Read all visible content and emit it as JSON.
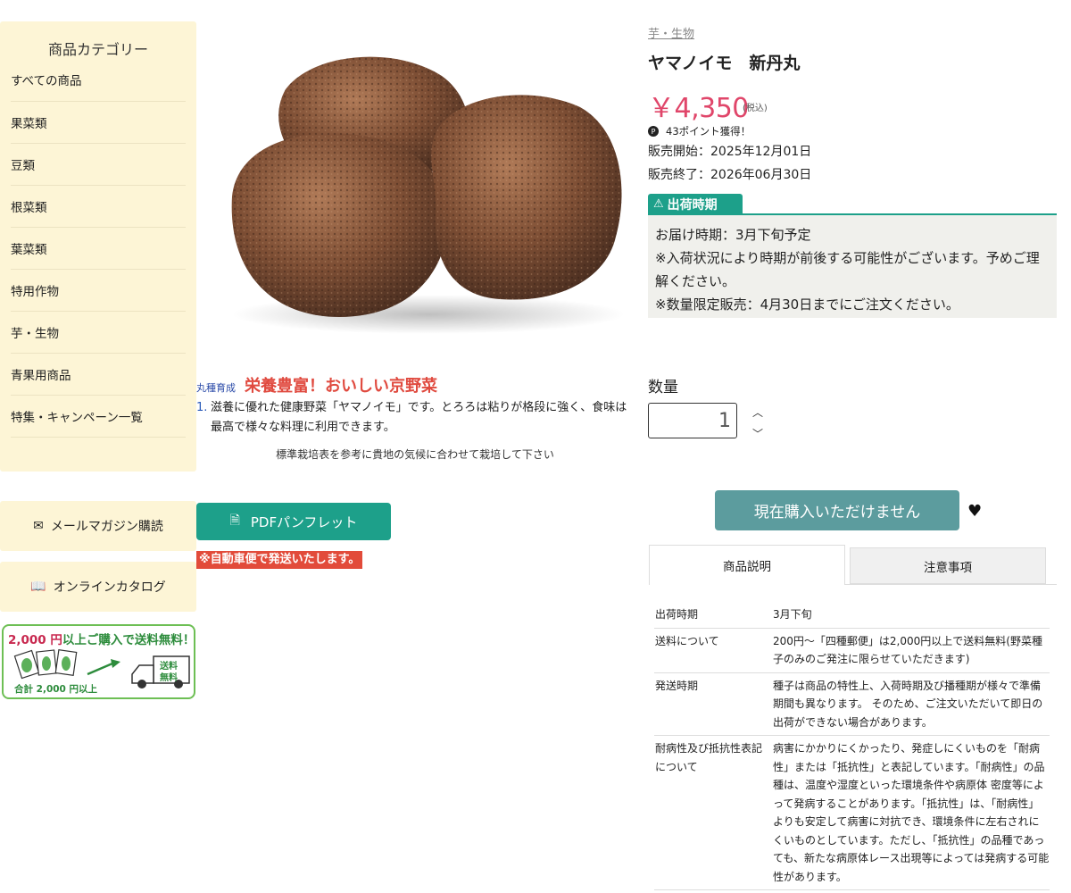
{
  "sidebar": {
    "category_title": "商品カテゴリー",
    "categories": [
      "すべての商品",
      "果菜類",
      "豆類",
      "根菜類",
      "葉菜類",
      "特用作物",
      "芋・生物",
      "青果用商品",
      "特集・キャンペーン一覧"
    ],
    "mail_magazine": "メールマガジン購読",
    "online_catalog": "オンラインカタログ",
    "shipping_banner": {
      "amount": "2,000 円",
      "text": "以上ご購入で送料無料！",
      "truck_label_1": "送料",
      "truck_label_2": "無料",
      "total_label": "合計 2,000 円以上"
    }
  },
  "product": {
    "breadcrumb": "芋・生物",
    "title": "ヤマノイモ　新丹丸",
    "price": "￥4,350",
    "tax_note": "(税込)",
    "points": "43ポイント獲得！",
    "sale_start": "販売開始：2025年12月01日",
    "sale_end": "販売終了：2026年06月30日",
    "shipping_period_label": "出荷時期",
    "shipping_lines": [
      "お届け時期：3月下旬予定",
      "※入荷状況により時期が前後する可能性がございます。予めご理解ください。",
      "※数量限定販売：4月30日までにご注文ください。"
    ],
    "quantity_label": "数量",
    "quantity_value": "1",
    "buy_button": "現在購入いただけません"
  },
  "description": {
    "variety": "丸種育成",
    "headline": "栄養豊富！おいしい京野菜",
    "item_number": "1.",
    "item_text": "滋養に優れた健康野菜「ヤマノイモ」です。とろろは粘りが格段に強く、食味は最高で様々な料理に利用できます。",
    "cultivation_note": "標準栽培表を参考に貴地の気候に合わせて栽培して下さい",
    "pdf_button": "PDFパンフレット",
    "shipping_note": "※自動車便で発送いたします。"
  },
  "tabs": {
    "description": "商品説明",
    "notes": "注意事項"
  },
  "spec": {
    "rows": [
      {
        "key": "出荷時期",
        "value": "3月下旬"
      },
      {
        "key": "送料について",
        "value": "200円〜「四種郵便」は2,000円以上で送料無料(野菜種子のみのご発注に限らせていただきます)"
      },
      {
        "key": "発送時期",
        "value": "種子は商品の特性上、入荷時期及び播種期が様々で準備期間も異なります。 そのため、ご注文いただいて即日の出荷ができない場合があります。"
      },
      {
        "key": "耐病性及び抵抗性表記について",
        "value": "病害にかかりにくかったり、発症しにくいものを「耐病性」または「抵抗性」と表記しています。「耐病性」の品種は、温度や湿度といった環境条件や病原体 密度等によって発病することがあります。「抵抗性」は、「耐病性」よりも安定して病害に対抗でき、環境条件に左右されにくいものとしています。ただし、「抵抗性」の品種であっても、新たな病原体レース出現等によっては発病する可能性があります。"
      }
    ]
  },
  "colors": {
    "sidebar_bg": "#fdf5d6",
    "accent_green": "#1da08a",
    "price_pink": "#e0466a",
    "headline_red": "#e04a3f",
    "buy_button_bg": "#5c9c9e"
  }
}
